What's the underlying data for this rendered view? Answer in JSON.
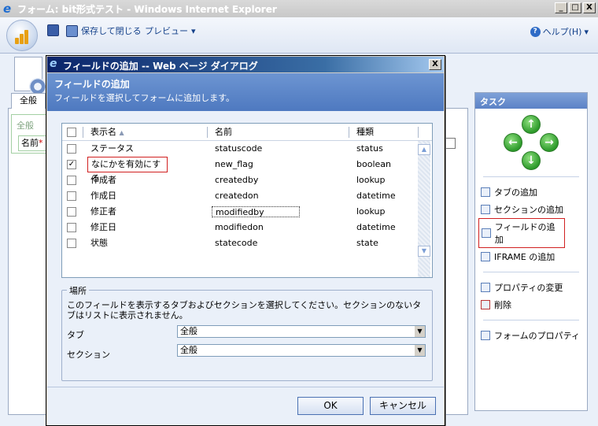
{
  "window": {
    "title": "フォーム: bit形式テスト - Windows Internet Explorer",
    "minimize": "_",
    "maximize": "□",
    "close": "X"
  },
  "toolbar": {
    "save_close_label": "保存して閉じる",
    "preview_label": "プレビュー",
    "preview_arrow": "▾",
    "help_label": "ヘルプ(H)",
    "help_arrow": "▾",
    "help_glyph": "?"
  },
  "form": {
    "tab_label": "全般",
    "section_label": "全般",
    "name_label": "名前",
    "required_mark": "*"
  },
  "task_panel": {
    "title": "タスク",
    "arrows": {
      "up": "↑",
      "left": "←",
      "right": "→",
      "down": "↓"
    },
    "items": [
      {
        "label": "タブの追加"
      },
      {
        "label": "セクションの追加"
      },
      {
        "label": "フィールドの追加"
      },
      {
        "label": "IFRAME の追加"
      },
      {
        "label": "プロパティの変更"
      },
      {
        "label": "削除"
      },
      {
        "label": "フォームのプロパティ"
      }
    ]
  },
  "dialog": {
    "title": "フィールドの追加 -- Web ページ ダイアログ",
    "close": "X",
    "header_title": "フィールドの追加",
    "header_subtitle": "フィールドを選択してフォームに追加します。",
    "grid": {
      "columns": {
        "display_name": "表示名",
        "sort_arrow": "▲",
        "name": "名前",
        "type": "種類"
      },
      "rows": [
        {
          "checked": false,
          "display_name": "ステータス",
          "name": "statuscode",
          "type": "status"
        },
        {
          "checked": true,
          "display_name": "なにかを有効にする",
          "name": "new_flag",
          "type": "boolean"
        },
        {
          "checked": false,
          "display_name": "作成者",
          "name": "createdby",
          "type": "lookup"
        },
        {
          "checked": false,
          "display_name": "作成日",
          "name": "createdon",
          "type": "datetime"
        },
        {
          "checked": false,
          "display_name": "修正者",
          "name": "modifiedby",
          "type": "lookup"
        },
        {
          "checked": false,
          "display_name": "修正日",
          "name": "modifiedon",
          "type": "datetime"
        },
        {
          "checked": false,
          "display_name": "状態",
          "name": "statecode",
          "type": "state"
        }
      ],
      "checkmark": "✓",
      "scroll_up": "▲",
      "scroll_down": "▼"
    },
    "location": {
      "legend": "場所",
      "description": "このフィールドを表示するタブおよびセクションを選択してください。セクションのないタブはリストに表示されません。",
      "tab_label": "タブ",
      "tab_value": "全般",
      "section_label": "セクション",
      "section_value": "全般",
      "dropdown_arrow": "▼"
    },
    "ok_label": "OK",
    "cancel_label": "キャンセル"
  }
}
